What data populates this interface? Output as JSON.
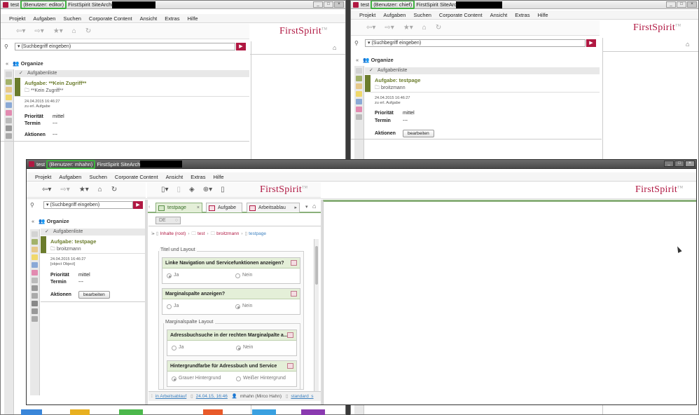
{
  "window_editor": {
    "title_prefix": "test",
    "user_label": "(Benutzer: editor)",
    "app_name": "FirstSpirit SiteArchitect",
    "menu": [
      "Projekt",
      "Aufgaben",
      "Suchen",
      "Corporate Content",
      "Ansicht",
      "Extras",
      "Hilfe"
    ],
    "brand": "FirstSpirit",
    "tm": "TM",
    "search_placeholder": "(Suchbegriff eingeben)",
    "panel_title": "Organize",
    "section_label": "Aufgabenliste",
    "task_title": "Aufgabe: **Kein Zugriff**",
    "task_folder": "**Kein Zugriff**",
    "date": "24.04.2015 16:46:27",
    "status": "zu erl. Aufgabe",
    "priority_label": "Priorität",
    "priority_value": "mittel",
    "due_label": "Termin",
    "due_value": "---",
    "actions_label": "Aktionen",
    "actions_value": "---"
  },
  "window_chief": {
    "title_prefix": "test",
    "user_label": "(Benutzer: chief)",
    "app_name": "FirstSpirit SiteArchitect",
    "menu": [
      "Projekt",
      "Aufgaben",
      "Suchen",
      "Corporate Content",
      "Ansicht",
      "Extras",
      "Hilfe"
    ],
    "brand": "FirstSpirit",
    "tm": "TM",
    "search_placeholder": "(Suchbegriff eingeben)",
    "panel_title": "Organize",
    "section_label": "Aufgabenliste",
    "task_title": "Aufgabe: testpage",
    "task_folder": "broitzmann",
    "date": "24.04.2015 16:46:27",
    "status": "zu erl. Aufgabe",
    "priority_label": "Priorität",
    "priority_value": "mittel",
    "due_label": "Termin",
    "due_value": "---",
    "actions_label": "Aktionen",
    "action_button": "bearbeiten"
  },
  "window_mhahn": {
    "title_prefix": "test",
    "user_label": "(Benutzer: mhahn)",
    "app_name": "FirstSpirit SiteArchitect",
    "menu": [
      "Projekt",
      "Aufgaben",
      "Suchen",
      "Corporate Content",
      "Ansicht",
      "Extras",
      "Hilfe"
    ],
    "brand": "FirstSpirit",
    "tm": "TM",
    "search_placeholder": "(Suchbegriff eingeben)",
    "panel_title": "Organize",
    "section_label": "Aufgabenliste",
    "task_title": "Aufgabe: testpage",
    "task_folder": "broitzmann",
    "date": "24.04.2015 16:46:27",
    "status": {
      "workflow": "in Arbeitsablauf",
      "timestamp": "24.04.15, 16:46",
      "user": "mhahn (Mirco Hahn)",
      "template": "standard_s"
    },
    "priority_label": "Priorität",
    "priority_value": "mittel",
    "due_label": "Termin",
    "due_value": "---",
    "actions_label": "Aktionen",
    "action_button": "bearbeiten",
    "tabs": [
      "testpage",
      "Aufgabe",
      "Arbeitsablau"
    ],
    "language": "DE",
    "breadcrumb": [
      "Inhalte (root)",
      "test",
      "broitzmann",
      "testpage"
    ],
    "form": {
      "group1": "Titel und Layout",
      "q1": "Linke Navigation und Servicefunktionen anzeigen?",
      "q2": "Marginalspalte anzeigen?",
      "group2": "Marginalspalte Layout",
      "q3": "Adressbuchsuche in der rechten Marginalpalte a...",
      "q4": "Hintergrundfarbe für Adressbuch und Service",
      "yes": "Ja",
      "no": "Nein",
      "opt_grey": "Grauer Hintergrund",
      "opt_white": "Weißer Hintergrund"
    }
  },
  "icons": [
    "back-arrow-icon",
    "forward-arrow-icon",
    "star-icon",
    "home-icon",
    "refresh-icon",
    "search-icon",
    "go-arrow-icon",
    "pin-icon",
    "collapse-icon",
    "users-icon",
    "checkmark-icon",
    "folder-icon",
    "close-icon"
  ],
  "colors": {
    "brand": "#b01842",
    "task_green": "#6b7c2c",
    "user_highlight": "#3fb23f"
  }
}
